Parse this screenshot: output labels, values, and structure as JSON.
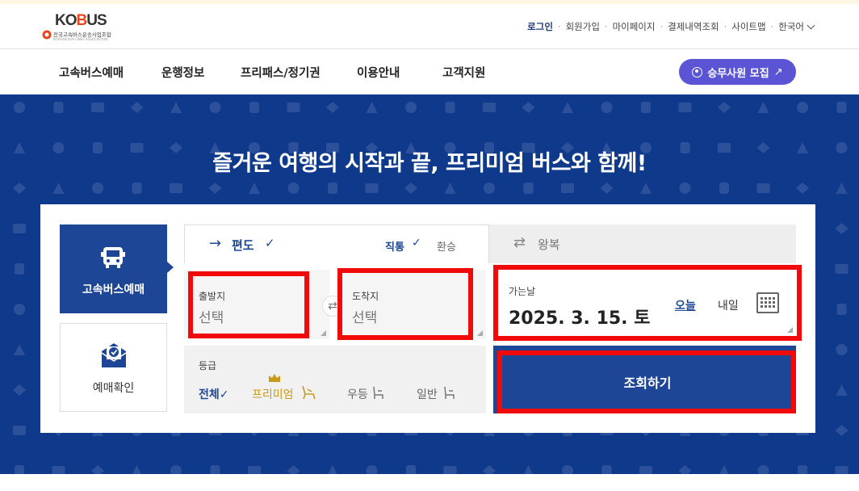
{
  "logo": {
    "word_pre": "KO",
    "word_o": "B",
    "word_post": "US",
    "org_name": "전국고속버스운송사업조합",
    "org_name_en": "KOREAN BUS LINES ASSOCIATION"
  },
  "util_menu": {
    "login": "로그인",
    "signup": "회원가입",
    "mypage": "마이페이지",
    "payment_history": "결제내역조회",
    "sitemap": "사이트맵",
    "language": "한국어"
  },
  "nav": {
    "items": [
      "고속버스예매",
      "운행정보",
      "프리패스/정기권",
      "이용안내",
      "고객지원"
    ],
    "recruit_button": "승무사원 모집",
    "recruit_arrow": "↗"
  },
  "hero": {
    "title": "즐거운 여행의 시작과 끝, 프리미엄 버스와 함께!"
  },
  "side": {
    "booking_label": "고속버스예매",
    "confirm_label": "예매확인"
  },
  "trip_tabs": {
    "oneway_arrow": "→",
    "oneway_label": "편도",
    "oneway_check": "✓",
    "direct_label": "직통",
    "direct_check": "✓",
    "transfer_label": "환승",
    "round_arrow": "⇄",
    "round_label": "왕복"
  },
  "departure": {
    "label": "출발지",
    "value": "선택"
  },
  "arrival": {
    "label": "도착지",
    "value": "선택"
  },
  "swap_icon": "⇄",
  "date": {
    "label": "가는날",
    "value": "2025. 3. 15. 토",
    "today": "오늘",
    "tomorrow": "내일"
  },
  "grade": {
    "label": "등급",
    "all": "전체✓",
    "premium": "프리미엄",
    "excellent": "우등",
    "normal": "일반"
  },
  "search_button": "조회하기",
  "colors": {
    "brand_blue": "#1e4696",
    "hero_bg": "#0f3a8c",
    "recruit_purple": "#5b55d6",
    "highlight_red": "#f00a0a",
    "premium_gold": "#c99a1a"
  }
}
